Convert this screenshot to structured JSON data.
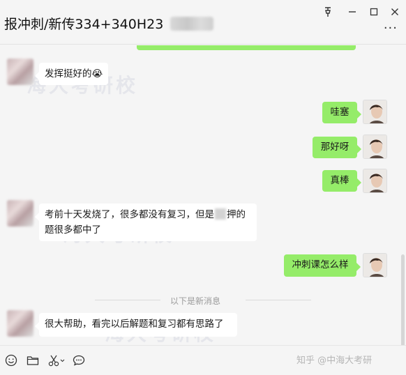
{
  "window": {
    "title": "报冲刺/新传334+340H23",
    "controls": [
      "pin-icon",
      "minimize-icon",
      "maximize-icon",
      "close-icon"
    ],
    "more_label": "···"
  },
  "messages": [
    {
      "side": "left",
      "text": "发挥挺好的😭"
    },
    {
      "side": "right",
      "text": "哇塞"
    },
    {
      "side": "right",
      "text": "那好呀"
    },
    {
      "side": "right",
      "text": "真棒"
    },
    {
      "side": "left",
      "text": "考前十天发烧了，很多都没有复习，但是",
      "text_line2": "押的",
      "text_line3": "题很多都中了"
    },
    {
      "side": "right",
      "text": "冲刺课怎么样"
    },
    {
      "side": "left",
      "text": "很大帮助，看完以后解题和复习都有思路了"
    }
  ],
  "new_messages_divider": "以下是新消息",
  "watermark_text": "海大考研校",
  "toolbar": {
    "icons": [
      "emoji-icon",
      "folder-icon",
      "scissors-icon",
      "chat-history-icon"
    ],
    "credit": "知乎 @中海大考研"
  },
  "colors": {
    "outgoing_bubble": "#95ec69",
    "incoming_bubble": "#ffffff",
    "background": "#f5f5f5"
  }
}
